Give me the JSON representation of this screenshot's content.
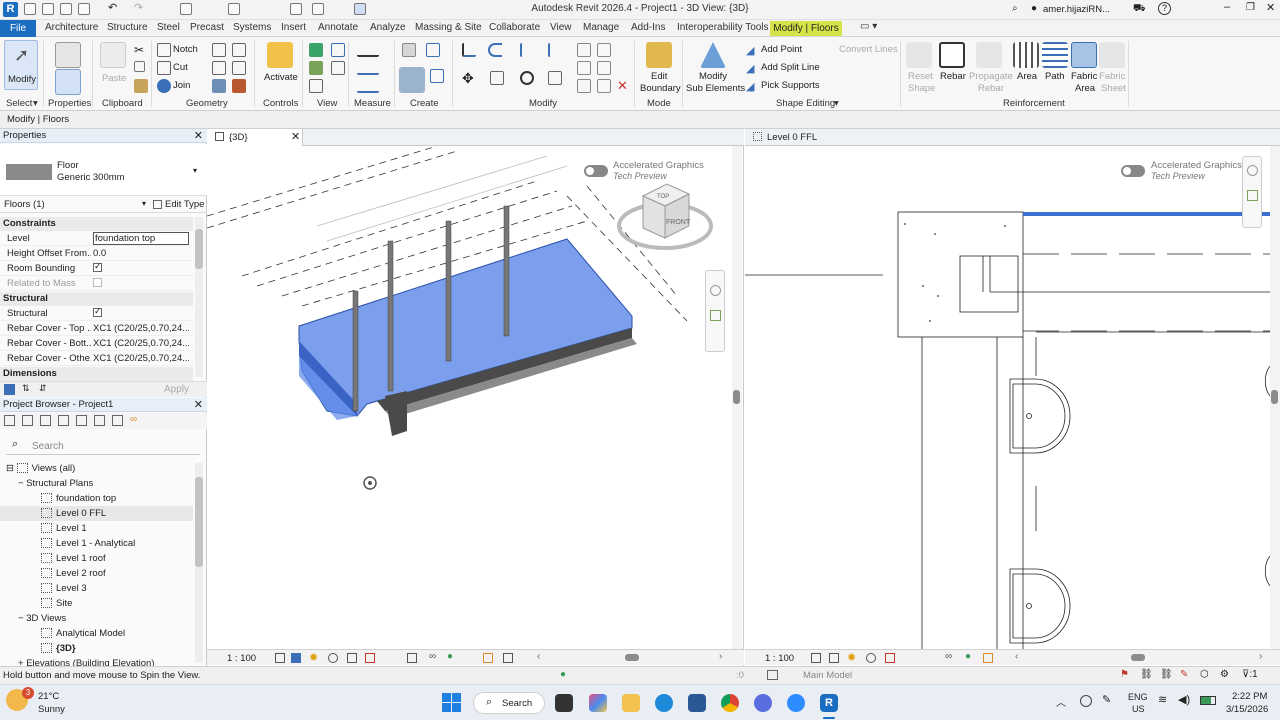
{
  "titlebar": {
    "title": "Autodesk Revit 2026.4 - Project1 - 3D View: {3D}",
    "user": "amer.hijaziRN...",
    "logo": "R"
  },
  "tabs": [
    "File",
    "Architecture",
    "Structure",
    "Steel",
    "Precast",
    "Systems",
    "Insert",
    "Annotate",
    "Analyze",
    "Massing & Site",
    "Collaborate",
    "View",
    "Manage",
    "Add-Ins",
    "Interoperability Tools",
    "Modify | Floors"
  ],
  "ribbon": {
    "select": "Select",
    "properties": "Properties",
    "clipboard": "Clipboard",
    "geometry": "Geometry",
    "controls": "Controls",
    "view": "View",
    "measure": "Measure",
    "create": "Create",
    "modify": "Modify",
    "mode": "Mode",
    "shape_editing": "Shape Editing",
    "reinforcement": "Reinforcement",
    "modify_btn": "Modify",
    "paste": "Paste",
    "notch": "Notch",
    "cut": "Cut",
    "join": "Join",
    "activate": "Activate",
    "edit_boundary_1": "Edit",
    "edit_boundary_2": "Boundary",
    "modify_sub_1": "Modify",
    "modify_sub_2": "Sub Elements",
    "add_point": "Add Point",
    "add_split_line": "Add Split Line",
    "pick_supports": "Pick Supports",
    "convert_lines": "Convert Lines",
    "reset_shape_1": "Reset",
    "reset_shape_2": "Shape",
    "rebar": "Rebar",
    "propagate_rebar_1": "Propagate",
    "propagate_rebar_2": "Rebar",
    "area": "Area",
    "path": "Path",
    "fabric_area_1": "Fabric",
    "fabric_area_2": "Area",
    "fabric_sheet_1": "Fabric",
    "fabric_sheet_2": "Sheet"
  },
  "context_bar": "Modify | Floors",
  "properties": {
    "title": "Properties",
    "type_name": "Floor",
    "type_sub": "Generic 300mm",
    "filter": "Floors (1)",
    "edit_type": "Edit Type",
    "constraints": "Constraints",
    "level_label": "Level",
    "level_value": "foundation top",
    "height_offset_label": "Height Offset From...",
    "height_offset_value": "0.0",
    "room_bounding": "Room Bounding",
    "related_to_mass": "Related to Mass",
    "structural_cat": "Structural",
    "structural": "Structural",
    "rebar_top_label": "Rebar Cover - Top ...",
    "rebar_top_value": "XC1 (C20/25,0.70,24...",
    "rebar_bottom_label": "Rebar Cover - Bott...",
    "rebar_bottom_value": "XC1 (C20/25,0.70,24...",
    "rebar_other_label": "Rebar Cover - Othe...",
    "rebar_other_value": "XC1 (C20/25,0.70,24...",
    "dimensions": "Dimensions",
    "apply": "Apply"
  },
  "browser": {
    "title": "Project Browser - Project1",
    "search": "Search",
    "views_all": "Views (all)",
    "structural_plans": "Structural Plans",
    "plans": [
      "foundation top",
      "Level 0 FFL",
      "Level 1",
      "Level 1 - Analytical",
      "Level 1 roof",
      "Level 2 roof",
      "Level 3",
      "Site"
    ],
    "views3d": "3D Views",
    "views3d_items": [
      "Analytical Model",
      "{3D}"
    ],
    "elevations": "Elevations (Building Elevation)"
  },
  "view3d": {
    "tab": "{3D}",
    "scale": "1 : 100",
    "ag_1": "Accelerated Graphics",
    "ag_2": "Tech Preview",
    "cube_top": "TOP",
    "cube_front": "FRONT"
  },
  "viewplan": {
    "tab": "Level 0 FFL",
    "scale": "1 : 100",
    "ag_1": "Accelerated Graphics",
    "ag_2": "Tech Preview"
  },
  "status": {
    "hint": "Hold button and move mouse to Spin the View.",
    "zero": ":0",
    "model": "Main Model"
  },
  "taskbar": {
    "temp": "21°C",
    "weather": "Sunny",
    "search": "Search",
    "lang": "ENG",
    "region": "US",
    "time": "2:22 PM",
    "date": "3/15/2026"
  },
  "colors": {
    "accent": "#1a6dc0",
    "context_tab": "#d6e44a",
    "floor_fill": "#5b87e8"
  }
}
